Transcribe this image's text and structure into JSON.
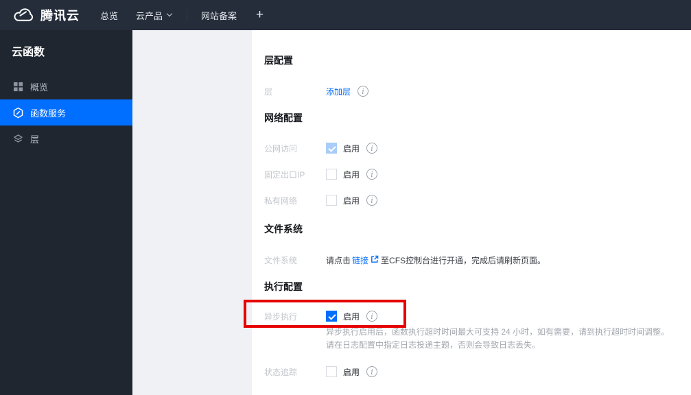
{
  "topbar": {
    "brand": "腾讯云",
    "nav": {
      "overview": "总览",
      "cloud_products": "云产品",
      "icp_filing": "网站备案",
      "plus": "+"
    }
  },
  "sidebar": {
    "title": "云函数",
    "items": [
      {
        "label": "概览",
        "icon": "grid-icon",
        "active": false
      },
      {
        "label": "函数服务",
        "icon": "function-hexagon-icon",
        "active": true
      },
      {
        "label": "层",
        "icon": "layers-icon",
        "active": false
      }
    ]
  },
  "content": {
    "section_layer": {
      "title": "层配置",
      "row": {
        "label": "层",
        "link_label": "添加层"
      }
    },
    "section_network": {
      "title": "网络配置",
      "rows": [
        {
          "label": "公网访问",
          "enable_label": "启用",
          "checked": true,
          "disabled": true
        },
        {
          "label": "固定出口IP",
          "enable_label": "启用",
          "checked": false,
          "disabled": false
        },
        {
          "label": "私有网络",
          "enable_label": "启用",
          "checked": false,
          "disabled": false
        }
      ]
    },
    "section_filesystem": {
      "title": "文件系统",
      "row": {
        "label": "文件系统",
        "text_before": "请点击",
        "link_label": "链接",
        "text_after": "至CFS控制台进行开通，完成后请刷新页面。"
      }
    },
    "section_execution": {
      "title": "执行配置",
      "row_async": {
        "label": "异步执行",
        "enable_label": "启用",
        "checked": true
      },
      "description_line1": "异步执行启用后，函数执行超时时间最大可支持 24 小时，如有需要，请到执行超时时间调整。",
      "description_line2": "请在日志配置中指定日志投递主题，否则会导致日志丢失。",
      "row_trace": {
        "label": "状态追踪",
        "enable_label": "启用",
        "checked": false
      }
    }
  },
  "annotation": {
    "type": "red-highlight-box",
    "target": "async-execution-row",
    "color": "#e60000"
  },
  "colors": {
    "accent": "#006eff",
    "topbar_bg": "#252d3b",
    "sidebar_bg": "#20262f",
    "active_item_bg": "#006eff",
    "page_gutter_bg": "#eff1f5",
    "checked_disabled_checkbox": "#a9cdf8",
    "annotation_red": "#e60000"
  }
}
